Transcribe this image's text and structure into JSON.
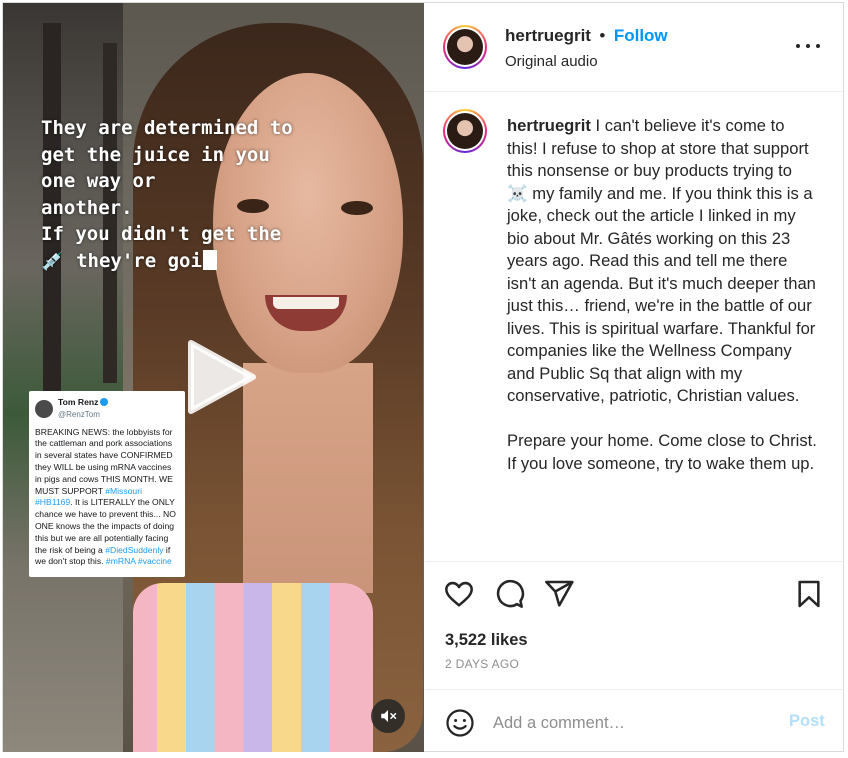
{
  "post": {
    "overlay_lines": [
      "They are determined to",
      "get the juice in you",
      "one way or",
      "another.",
      "If you didn't get the",
      "💉 they're goi"
    ],
    "tweet": {
      "name": "Tom Renz",
      "handle": "@RenzTom",
      "text_before": "BREAKING NEWS: the lobbyists for the cattleman and pork associations in several states have CONFIRMED they WILL be using mRNA vaccines in pigs and cows THIS MONTH. WE MUST SUPPORT ",
      "tag1": "#Missouri #HB1169",
      "text_mid": ". It is LITERALLY the ONLY chance we have to prevent this... NO ONE knows the the impacts of doing this but we are all potentially facing the risk of being a ",
      "tag2": "#DiedSuddenly",
      "text_after": " if we don't stop this. ",
      "tag3": "#mRNA #vaccine"
    }
  },
  "header": {
    "username": "hertruegrit",
    "separator": "•",
    "follow_label": "Follow",
    "audio_label": "Original audio"
  },
  "caption": {
    "username": "hertruegrit",
    "paragraph1": " I can't believe it's come to this! I refuse to shop at store that support this nonsense or buy products trying to ☠️ my family and me. If you think this is a joke, check out the article I linked in my bio about Mr. Gâtés working on this 23 years ago. Read this and tell me there isn't an agenda. But it's much deeper than just this… friend, we're in the battle of our lives. This is spiritual warfare. Thankful for companies like the Wellness Company and Public Sq that align with my conservative, patriotic, Christian values.",
    "paragraph2": "Prepare your home. Come close to Christ. If you love someone, try to wake them up."
  },
  "stats": {
    "likes": "3,522 likes",
    "time": "2 DAYS AGO"
  },
  "comment": {
    "placeholder": "Add a comment…",
    "post_label": "Post"
  },
  "colors": {
    "accent": "#0095f6",
    "post_disabled": "#b2dffc"
  }
}
